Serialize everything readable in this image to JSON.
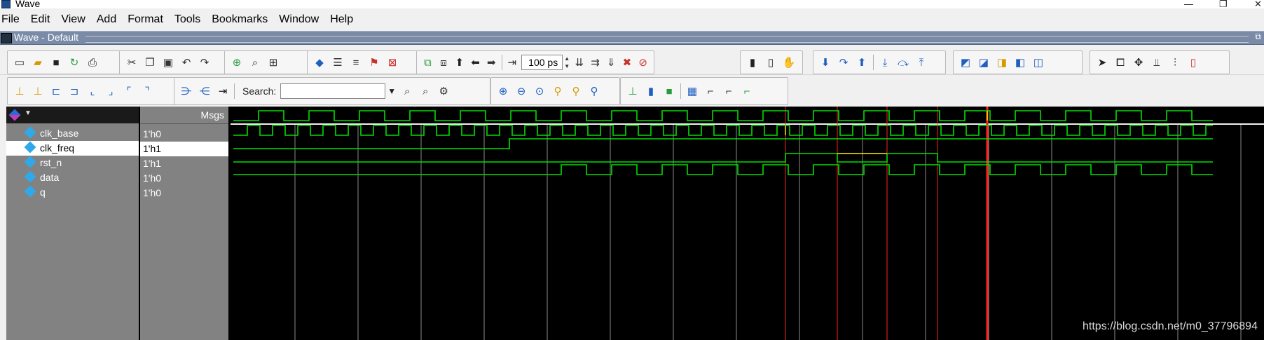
{
  "window": {
    "title": "Wave"
  },
  "menu": {
    "items": [
      "File",
      "Edit",
      "View",
      "Add",
      "Format",
      "Tools",
      "Bookmarks",
      "Window",
      "Help"
    ]
  },
  "wave_window": {
    "title": "Wave - Default"
  },
  "toolbar1": {
    "zoom_value": "100",
    "zoom_unit": "ps",
    "icons": [
      "new-icon",
      "open-icon",
      "save-icon",
      "reload-icon",
      "print-icon",
      "cut-icon",
      "copy-icon",
      "paste-icon",
      "undo-icon",
      "redo-icon",
      "add-icon",
      "find-icon",
      "pin-icon",
      "compile-icon",
      "simulate-icon",
      "restart-icon",
      "break-icon",
      "stop-icon",
      "step-icon",
      "up-icon",
      "back-icon",
      "forward-icon",
      "zoom-step-icon",
      "run-icon",
      "continue-icon",
      "run-all-icon",
      "break-at-icon",
      "stop-sim-icon",
      "dataflow-icon",
      "chart-icon",
      "hand-icon",
      "step-into-icon",
      "step-over-icon",
      "step-out-icon",
      "step-into-dark-icon",
      "step-over-dark-icon",
      "step-out-dark-icon",
      "layout-icon",
      "pointer-icon",
      "zoom-mode-icon",
      "move-icon",
      "edit-icon",
      "cursor-icon",
      "waves-icon",
      "bars-icon"
    ]
  },
  "toolbar2": {
    "search_label": "Search:",
    "search_value": "",
    "icons": [
      "edge-first-icon",
      "edge-last-icon",
      "prev-edge-icon",
      "next-edge-icon",
      "prev-falling-icon",
      "next-falling-icon",
      "prev-rising-icon",
      "next-rising-icon",
      "insert-cursor-icon",
      "delete-cursor-icon",
      "lock-cursor-icon",
      "search-prev-icon",
      "search-next-icon",
      "search-opt-icon",
      "zoom-in-icon",
      "zoom-out-icon",
      "zoom-full-icon",
      "zoom-cursor-icon",
      "zoom-range-icon",
      "zoom-last-icon",
      "signal-mode-icon",
      "bar-mode-icon",
      "box-mode-icon",
      "grid-icon",
      "rising-mode-icon",
      "falling-mode-icon"
    ]
  },
  "panel": {
    "msgs_header": "Msgs",
    "signals": [
      {
        "name": "clk_base",
        "value": "1'h0"
      },
      {
        "name": "clk_freq",
        "value": "1'h1"
      },
      {
        "name": "rst_n",
        "value": "1'h1"
      },
      {
        "name": "data",
        "value": "1'h0"
      },
      {
        "name": "q",
        "value": "1'h0"
      }
    ]
  },
  "colors": {
    "wave": "#00e000",
    "cursor": "#ff2020",
    "grid": "#8a8a8a",
    "highlight": "#ffea00"
  },
  "watermark": "https://blog.csdn.net/m0_37796894"
}
